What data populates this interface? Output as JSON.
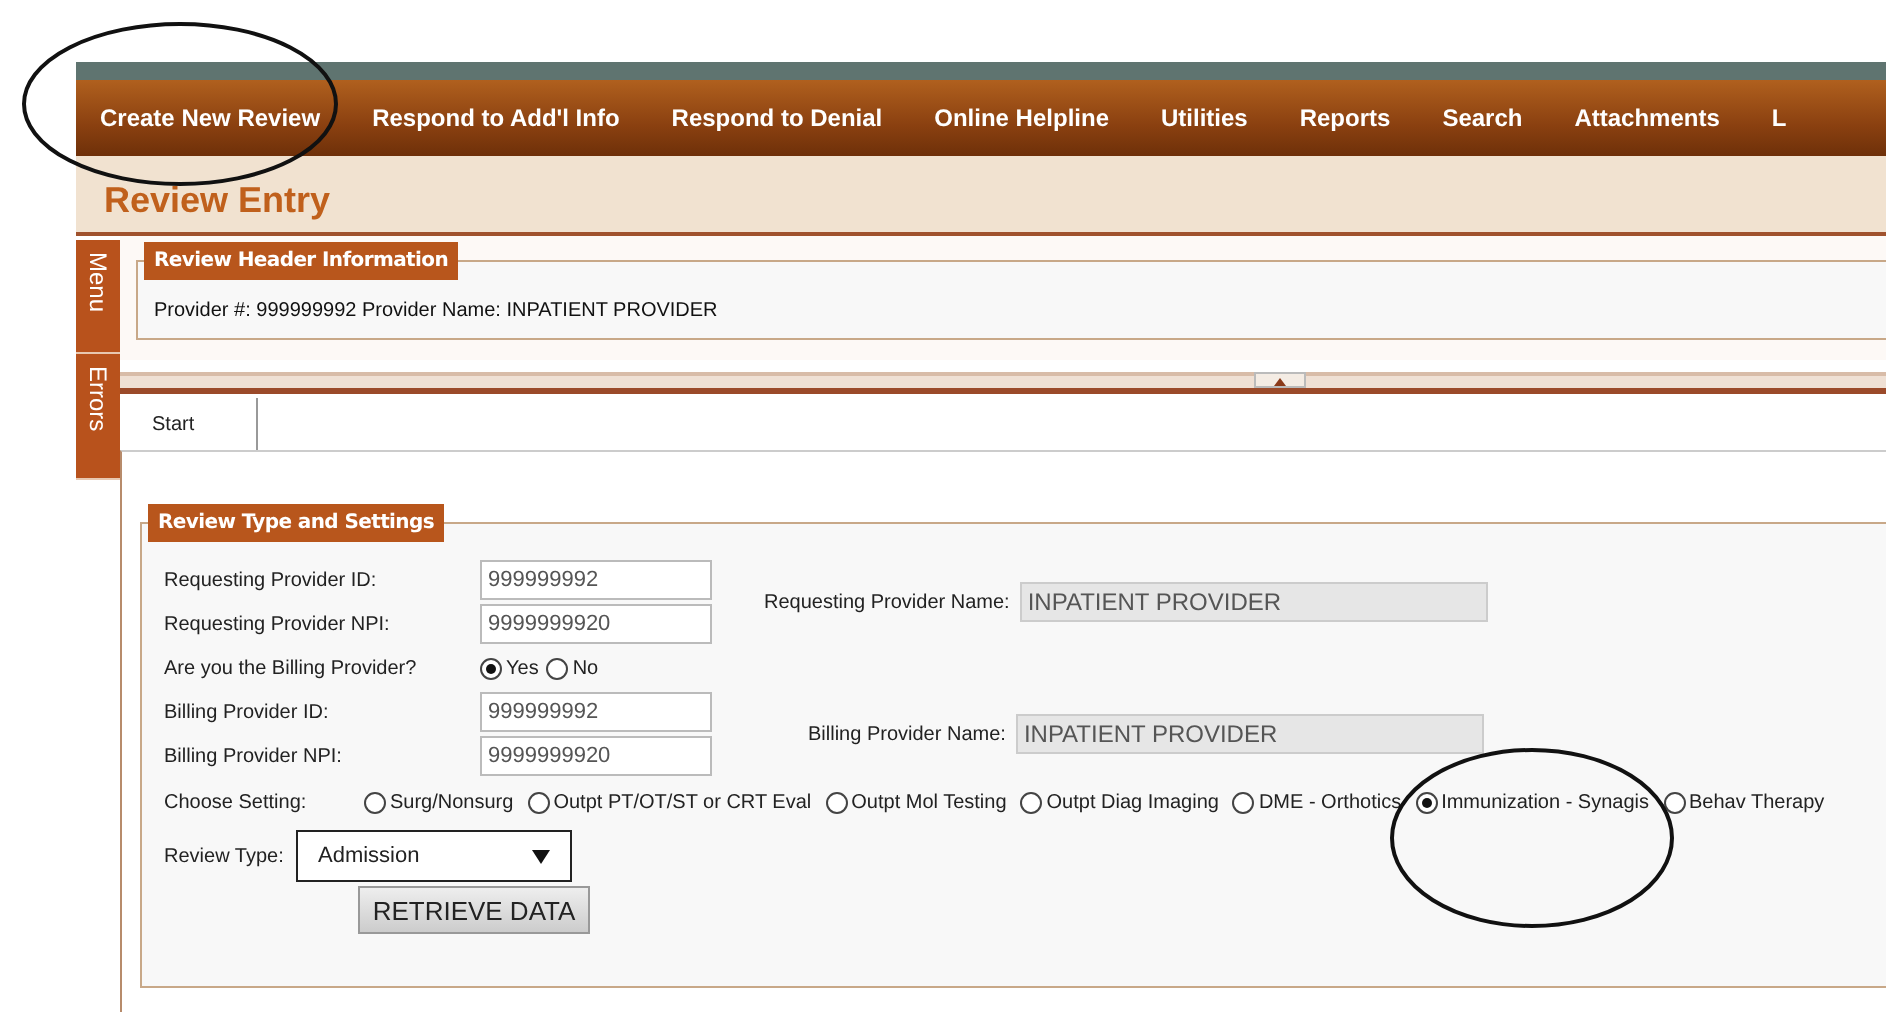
{
  "nav": {
    "items": [
      {
        "label": "Create New Review"
      },
      {
        "label": "Respond to Add'l Info"
      },
      {
        "label": "Respond to Denial"
      },
      {
        "label": "Online Helpline"
      },
      {
        "label": "Utilities"
      },
      {
        "label": "Reports"
      },
      {
        "label": "Search"
      },
      {
        "label": "Attachments"
      },
      {
        "label": "L"
      }
    ]
  },
  "page_title": "Review Entry",
  "side_tabs": [
    "Menu",
    "Errors"
  ],
  "header_section": {
    "title": "Review Header Information",
    "text": "Provider #: 999999992 Provider Name: INPATIENT PROVIDER"
  },
  "tabs": [
    {
      "label": "Start",
      "selected": true
    }
  ],
  "settings": {
    "title": "Review Type and Settings",
    "requesting_id": {
      "label": "Requesting Provider ID:",
      "value": "999999992"
    },
    "requesting_npi": {
      "label": "Requesting Provider NPI:",
      "value": "9999999920"
    },
    "requesting_name": {
      "label": "Requesting Provider Name:",
      "value": "INPATIENT PROVIDER"
    },
    "billing_question": {
      "label": "Are you the Billing Provider?",
      "options": [
        {
          "label": "Yes",
          "selected": true
        },
        {
          "label": "No",
          "selected": false
        }
      ]
    },
    "billing_id": {
      "label": "Billing Provider ID:",
      "value": "999999992"
    },
    "billing_npi": {
      "label": "Billing Provider NPI:",
      "value": "9999999920"
    },
    "billing_name": {
      "label": "Billing Provider Name:",
      "value": "INPATIENT PROVIDER"
    },
    "choose_setting": {
      "label": "Choose Setting:",
      "options": [
        {
          "label": "Surg/Nonsurg",
          "selected": false
        },
        {
          "label": "Outpt PT/OT/ST or CRT Eval",
          "selected": false
        },
        {
          "label": "Outpt Mol Testing",
          "selected": false
        },
        {
          "label": "Outpt Diag Imaging",
          "selected": false
        },
        {
          "label": "DME - Orthotics",
          "selected": false
        },
        {
          "label": "Immunization - Synagis",
          "selected": true
        },
        {
          "label": "Behav Therapy",
          "selected": false
        }
      ]
    },
    "review_type": {
      "label": "Review Type:",
      "value": "Admission"
    },
    "retrieve_button": "RETRIEVE DATA"
  }
}
